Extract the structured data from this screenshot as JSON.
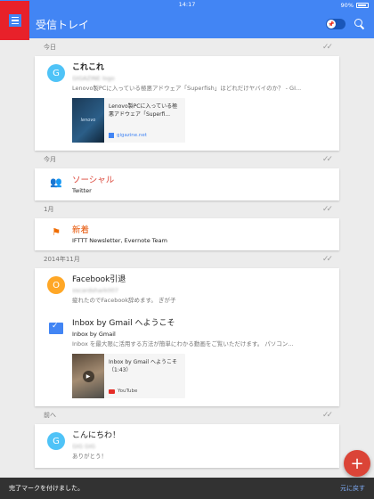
{
  "status_bar": {
    "time": "14:17",
    "battery": "90%"
  },
  "header": {
    "title": "受信トレイ",
    "color": "#4285f4",
    "highlight_color": "#e8212a"
  },
  "sections": [
    {
      "label": "今日"
    },
    {
      "label": "今月"
    },
    {
      "label": "1月"
    },
    {
      "label": "2014年11月"
    },
    {
      "label": "前へ"
    }
  ],
  "items": {
    "today": {
      "avatar_letter": "G",
      "avatar_color": "#4fc3f7",
      "sender": "これこれ",
      "recipient": "GIGAZINE logo",
      "snippet": "Lenovo製PCに入っている極悪アドウェア「Superfish」はどれだけヤバイのか？ - GI...",
      "attachment": {
        "thumb_text": "lenovo",
        "title": "Lenovo製PCに入っている極悪アドウェア「Superfi...",
        "source": "gigazine.net"
      }
    },
    "social": {
      "name": "ソーシャル",
      "sub": "Twitter",
      "icon": "people-icon"
    },
    "updates": {
      "name": "新着",
      "sub": "IFTTT Newsletter, Evernote Team",
      "icon": "flag-icon"
    },
    "facebook": {
      "avatar_letter": "O",
      "avatar_color": "#ffa726",
      "sender": "Facebook引退",
      "recipient": "oscardshark007",
      "snippet": "疲れたのでFacebook辞めます。 ぎが子"
    },
    "inbox": {
      "sender": "Inbox by Gmail へようこそ",
      "sub": "Inbox by Gmail",
      "snippet": "Inbox を最大限に活用する方法が簡単にわかる動画をご覧いただけます。 パソコン...",
      "attachment": {
        "title": "Inbox by Gmail へようこそ",
        "duration": "（1:43）",
        "source": "YouTube"
      }
    },
    "hello": {
      "avatar_letter": "G",
      "avatar_color": "#4fc3f7",
      "sender": "こんにちわ！",
      "recipient": "GIG GIG",
      "snippet": "ありがとう！"
    }
  },
  "snackbar": {
    "message": "完了マークを付けました。",
    "action": "元に戻す"
  },
  "fab": {
    "label": "+"
  }
}
